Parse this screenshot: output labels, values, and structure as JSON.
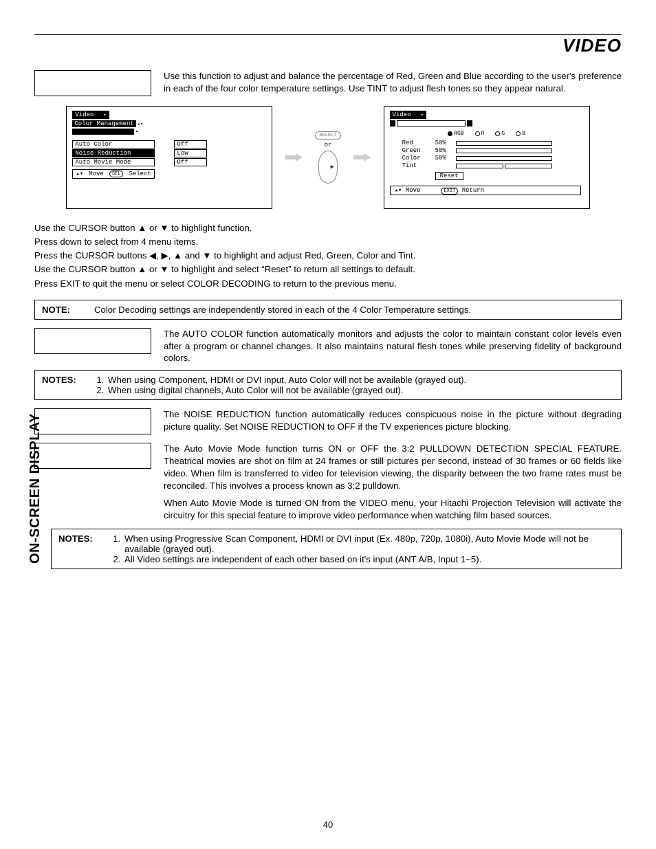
{
  "page": {
    "title": "VIDEO",
    "sidebar": "ON-SCREEN DISPLAY",
    "number": "40"
  },
  "intro": "Use this function to adjust and balance the percentage of Red, Green and Blue according to the user's preference in each of the four color temperature settings.  Use TINT to adjust flesh tones so they appear natural.",
  "osd_left": {
    "title": "Video",
    "sub": "Color Management",
    "items": [
      {
        "label": "Auto Color",
        "value": "Off",
        "hl": false
      },
      {
        "label": "Noise Reduction",
        "value": "Low",
        "hl": true
      },
      {
        "label": "Auto Movie Mode",
        "value": "Off",
        "hl": false
      }
    ],
    "foot_move": "Move",
    "foot_sel_pill": "SEL",
    "foot_select": "Select"
  },
  "mid": {
    "select_label": "SELECT",
    "or": "or"
  },
  "osd_right": {
    "title": "Video",
    "radios": [
      "RGB",
      "R",
      "G",
      "B"
    ],
    "rows": [
      {
        "lbl": "Red",
        "num": "50%",
        "fill": 50
      },
      {
        "lbl": "Green",
        "num": "50%",
        "fill": 50
      },
      {
        "lbl": "Color",
        "num": "50%",
        "fill": 50
      }
    ],
    "tint": "Tint",
    "reset": "Reset",
    "foot_move": "Move",
    "foot_exit_pill": "EXIT",
    "foot_return": "Return"
  },
  "instr": {
    "l1": "Use the CURSOR button ▲ or ▼ to highlight function.",
    "l2": "Press down to select from 4 menu items.",
    "l3": "Press the CURSOR buttons ◀, ▶, ▲ and ▼ to highlight and adjust Red, Green, Color and Tint.",
    "l4": "Use the CURSOR button ▲ or ▼ to highlight and select “Reset” to return all settings to default.",
    "l5": "Press EXIT to quit the menu or select COLOR DECODING to return to the previous menu."
  },
  "note1": {
    "label": "NOTE:",
    "text": "Color Decoding settings are independently stored in each of the 4 Color Temperature settings."
  },
  "auto_color": "The AUTO COLOR function automatically monitors and adjusts the color to maintain constant color levels even after a program or channel changes. It also maintains natural flesh tones while preserving fidelity of background colors.",
  "notes2": {
    "label": "NOTES:",
    "i1": "When using Component, HDMI or DVI input, Auto Color will not be available (grayed out).",
    "i2": "When using digital channels, Auto Color will not be available (grayed out)."
  },
  "noise_red": "The NOISE REDUCTION function automatically reduces conspicuous noise in the picture without degrading picture quality.  Set NOISE REDUCTION to OFF if the TV experiences picture blocking.",
  "auto_movie": "The Auto Movie Mode function turns ON or OFF the 3:2 PULLDOWN DETECTION SPECIAL FEATURE. Theatrical movies are shot on film at 24 frames or still pictures per second, instead of 30 frames or 60 fields like video.  When film is transferred to video for television viewing, the disparity between the two frame rates must be reconciled.  This involves a process known as 3:2 pulldown.",
  "auto_movie2": "When Auto Movie Mode is turned ON from the VIDEO menu, your Hitachi Projection Television will activate the circuitry for this special feature to improve video performance when watching film based sources.",
  "notes3": {
    "label": "NOTES:",
    "i1": "When using Progressive Scan Component, HDMI or DVI input (Ex. 480p, 720p, 1080i), Auto Movie Mode will not be available (grayed out).",
    "i2": "All Video settings are independent of each other based on it's input (ANT A/B, Input 1~5)."
  }
}
